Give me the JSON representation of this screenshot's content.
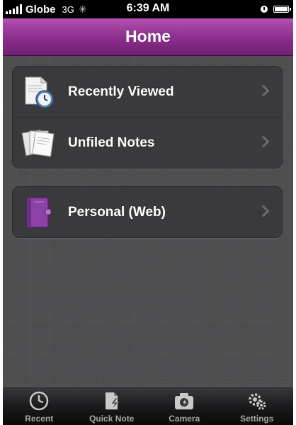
{
  "status_bar": {
    "carrier": "Globe",
    "network": "3G",
    "time": "6:39 AM",
    "icons": [
      "signal-bars-icon",
      "loading-spinner-icon",
      "alarm-clock-icon",
      "battery-icon"
    ]
  },
  "nav_bar": {
    "title": "Home",
    "accent_color": "#8a2d8b"
  },
  "groups": [
    {
      "items": [
        {
          "label": "Recently Viewed",
          "icon": "recent-document-clock-icon"
        },
        {
          "label": "Unfiled Notes",
          "icon": "notes-stack-icon"
        }
      ]
    },
    {
      "items": [
        {
          "label": "Personal (Web)",
          "icon": "notebook-icon",
          "icon_color": "#8d42a6"
        }
      ]
    }
  ],
  "tab_bar": {
    "tabs": [
      {
        "label": "Recent",
        "icon": "clock-icon"
      },
      {
        "label": "Quick Note",
        "icon": "quick-note-icon"
      },
      {
        "label": "Camera",
        "icon": "camera-icon"
      },
      {
        "label": "Settings",
        "icon": "settings-gears-icon"
      }
    ]
  }
}
